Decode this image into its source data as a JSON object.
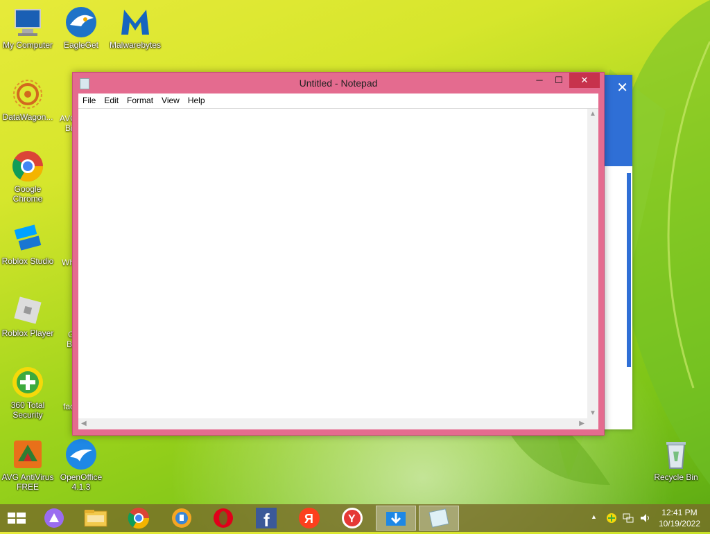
{
  "desktop": {
    "icons": [
      {
        "label": "My Computer",
        "icon": "computer-icon"
      },
      {
        "label": "EagleGet",
        "icon": "eagleget-icon"
      },
      {
        "label": "Malwarebytes",
        "icon": "malwarebytes-icon"
      },
      {
        "label": "DataWagon...",
        "icon": "datawagon-icon"
      },
      {
        "label": "Google Chrome",
        "icon": "chrome-icon"
      },
      {
        "label": "Roblox Studio",
        "icon": "roblox-studio-icon"
      },
      {
        "label": "Roblox Player",
        "icon": "roblox-player-icon"
      },
      {
        "label": "360 Total Security",
        "icon": "360-security-icon"
      },
      {
        "label": "AVG AntiVirus FREE",
        "icon": "avg-icon"
      },
      {
        "label": "OpenOffice 4.1.3",
        "icon": "openoffice-icon"
      },
      {
        "label": "Recycle Bin",
        "icon": "recycle-bin-icon"
      }
    ],
    "partial_labels": [
      "AVG",
      "Bi",
      "Wh",
      "G",
      "Bi",
      "fac"
    ]
  },
  "notepad": {
    "title": "Untitled - Notepad",
    "menu": [
      "File",
      "Edit",
      "Format",
      "View",
      "Help"
    ],
    "content": ""
  },
  "taskbar": {
    "apps": [
      "start",
      "cortana",
      "file-explorer",
      "chrome",
      "360-browser",
      "opera",
      "facebook",
      "yandex",
      "yandex-browser",
      "downloader",
      "notepad"
    ],
    "clock": {
      "time": "12:41 PM",
      "date": "10/19/2022"
    }
  },
  "colors": {
    "notepad_frame": "#e46b8f",
    "close": "#c7324c",
    "taskbar": "#786e28"
  }
}
